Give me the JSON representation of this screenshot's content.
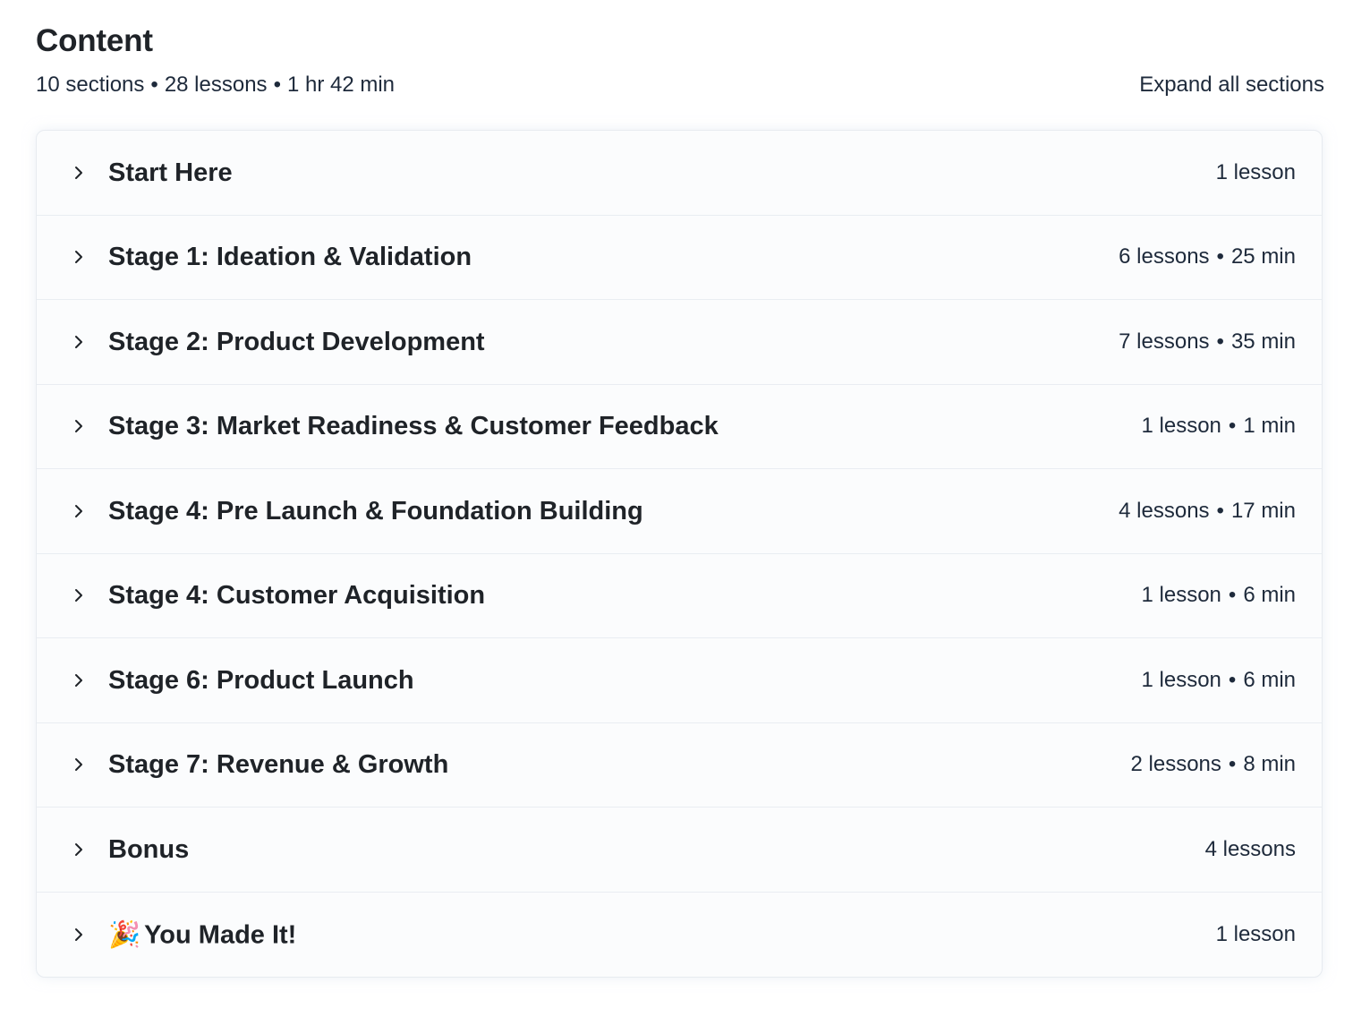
{
  "header": {
    "title": "Content",
    "summary": {
      "sections": "10 sections",
      "lessons": "28 lessons",
      "duration": "1 hr 42 min",
      "separator": "•"
    },
    "expand_label": "Expand all sections"
  },
  "sections": [
    {
      "title": "Start Here",
      "lessons": "1 lesson",
      "duration": ""
    },
    {
      "title": "Stage 1: Ideation & Validation",
      "lessons": "6 lessons",
      "duration": "25 min"
    },
    {
      "title": "Stage 2: Product Development",
      "lessons": "7 lessons",
      "duration": "35 min"
    },
    {
      "title": "Stage 3: Market Readiness & Customer Feedback",
      "lessons": "1 lesson",
      "duration": "1 min"
    },
    {
      "title": "Stage 4: Pre Launch & Foundation Building",
      "lessons": "4 lessons",
      "duration": "17 min"
    },
    {
      "title": "Stage 4: Customer Acquisition",
      "lessons": "1 lesson",
      "duration": "6 min"
    },
    {
      "title": "Stage 6: Product Launch",
      "lessons": "1 lesson",
      "duration": "6 min"
    },
    {
      "title": "Stage 7: Revenue & Growth",
      "lessons": "2 lessons",
      "duration": "8 min"
    },
    {
      "title": "Bonus",
      "lessons": "4 lessons",
      "duration": ""
    },
    {
      "title": "You Made It!",
      "emoji": "🎉",
      "lessons": "1 lesson",
      "duration": ""
    }
  ],
  "icons": {
    "chevron": "chevron-right-icon"
  },
  "colors": {
    "text": "#1f2328",
    "meta_text": "#1e2a3b",
    "border": "#e7ebf0",
    "panel_bg": "#fbfcfd"
  }
}
